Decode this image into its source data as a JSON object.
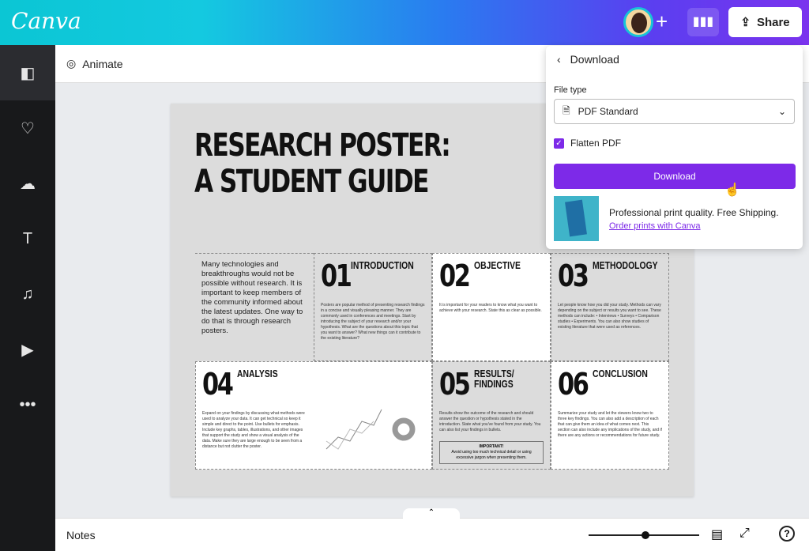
{
  "header": {
    "logo": "Canva",
    "share_label": "Share"
  },
  "sidebar": {
    "items": [
      "design-panel",
      "elements",
      "uploads",
      "text",
      "audio",
      "videos",
      "more"
    ]
  },
  "toolbar": {
    "animate_label": "Animate"
  },
  "poster": {
    "title_line1": "RESEARCH POSTER:",
    "title_line2": "A STUDENT GUIDE",
    "intro": "Many technologies and breakthroughs would not be possible without research. It is important to keep members of the community informed about the latest updates. One way to do that is through research posters.",
    "sections": [
      {
        "num": "01",
        "head": "INTRODUCTION",
        "body": "Posters are popular method of presenting research findings in a concise and visually pleasing manner. They are commonly used in conferences and meetings. Start by introducing the subject of your research and/or your hypothesis. What are the questions about this topic that you want to answer? What new things can it contribute to the existing literature?"
      },
      {
        "num": "02",
        "head": "OBJECTIVE",
        "body": "It is important for your readers to know what you want to achieve with your research. State this as clear as possible."
      },
      {
        "num": "03",
        "head": "METHODOLOGY",
        "body": "Let people know how you did your study. Methods can vary depending on the subject or results you want to see. These methods can include: • Interviews • Surveys • Comparison studies • Experiments. You can also show studies of existing literature that were used as references."
      },
      {
        "num": "04",
        "head": "ANALYSIS",
        "body": "Expand on your findings by discussing what methods were used to analyze your data. It can get technical so keep it simple and direct to the point. Use bullets for emphasis. Include key graphs, tables, illustrations, and other images that support the study and show a visual analysis of the data. Make sure they are large enough to be seen from a distance but not clutter the poster."
      },
      {
        "num": "05",
        "head": "RESULTS/ FINDINGS",
        "body": "Results show the outcome of the research and should answer the question or hypothesis stated in the introduction. State what you've found from your study. You can also list your findings in bullets.",
        "important_title": "IMPORTANT!",
        "important_body": "Avoid using too much technical detail or using excessive jargon when presenting them."
      },
      {
        "num": "06",
        "head": "CONCLUSION",
        "body": "Summarize your study and let the viewers know two to three key findings. You can also add a description of each that can give them an idea of what comes next. This section can also include any implications of the study, and if there are any actions or recommendations for future study."
      }
    ]
  },
  "bottom": {
    "notes_label": "Notes",
    "zoom_fraction": 0.5
  },
  "download_panel": {
    "title": "Download",
    "file_type_label": "File type",
    "file_type_value": "PDF Standard",
    "flatten_label": "Flatten PDF",
    "flatten_checked": true,
    "download_label": "Download",
    "print_text": "Professional print quality. Free Shipping.",
    "order_link": "Order prints with Canva",
    "accent": "#7d2ae8"
  }
}
